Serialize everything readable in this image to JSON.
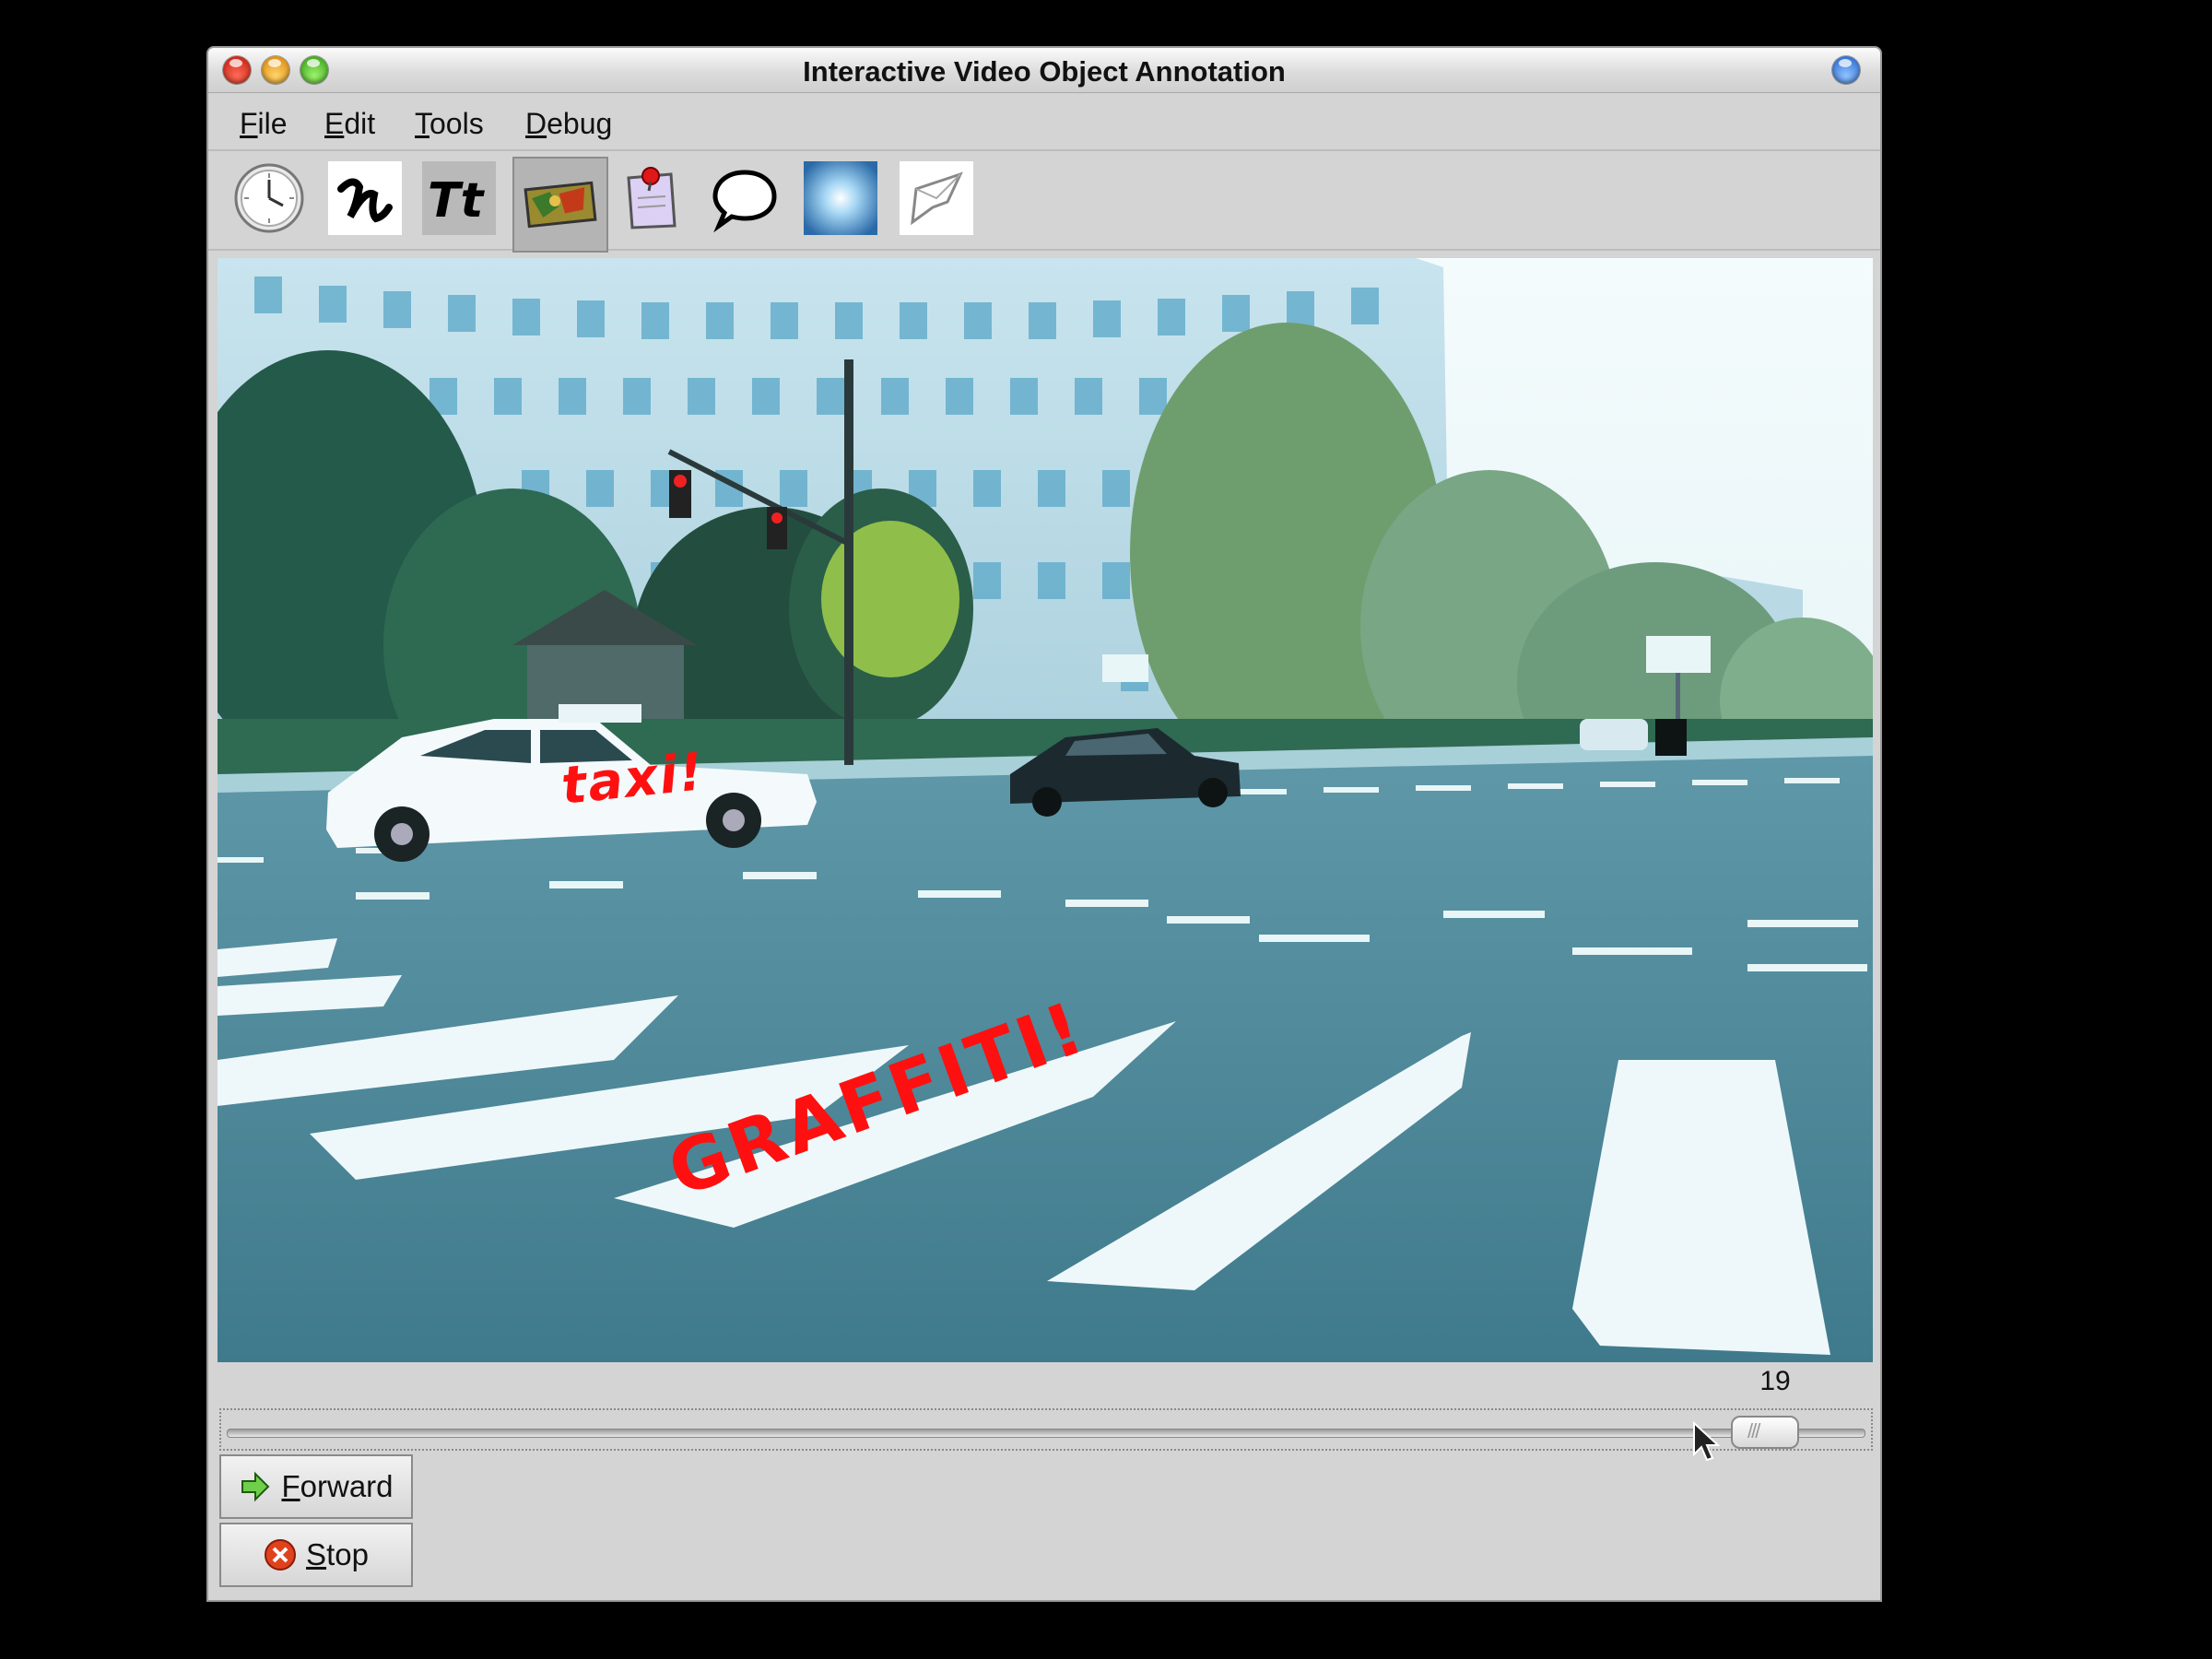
{
  "window": {
    "title": "Interactive Video Object Annotation"
  },
  "menu": {
    "items": [
      "File",
      "Edit",
      "Tools",
      "Debug"
    ]
  },
  "toolbar": {
    "tools": [
      {
        "icon": "clock-icon",
        "selected": false
      },
      {
        "icon": "freehand-draw-icon",
        "selected": false
      },
      {
        "icon": "text-tool-icon",
        "selected": false
      },
      {
        "icon": "texture-paint-icon",
        "selected": true
      },
      {
        "icon": "pinned-note-icon",
        "selected": false
      },
      {
        "icon": "speech-bubble-icon",
        "selected": false
      },
      {
        "icon": "glow-effect-icon",
        "selected": false
      },
      {
        "icon": "shape-sketch-icon",
        "selected": false
      }
    ]
  },
  "video": {
    "annotations": {
      "taxi_label": "taxi!",
      "crosswalk_label": "GRAFFITI!"
    }
  },
  "playback": {
    "frame_number": "19",
    "forward_label": "Forward",
    "stop_label": "Stop",
    "colors": {
      "annotation": "#ff1010"
    }
  }
}
